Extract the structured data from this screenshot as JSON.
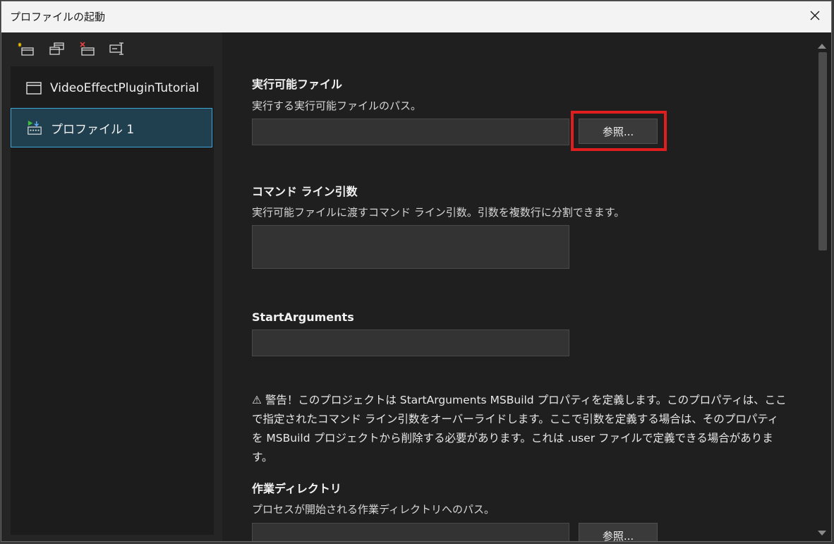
{
  "window": {
    "title": "プロファイルの起動",
    "close_glyph": "✕"
  },
  "toolbar": {
    "icons": [
      "new-profile-icon",
      "duplicate-profile-icon",
      "delete-profile-icon",
      "rename-profile-icon"
    ]
  },
  "tree": {
    "items": [
      {
        "label": "VideoEffectPluginTutorial",
        "icon": "window-icon",
        "selected": false
      },
      {
        "label": "プロファイル 1",
        "icon": "profile-launch-icon",
        "selected": true
      }
    ]
  },
  "executable": {
    "title": "実行可能ファイル",
    "description": "実行する実行可能ファイルのパス。",
    "value": "",
    "browse_label": "参照..."
  },
  "command_line": {
    "title": "コマンド ライン引数",
    "description": "実行可能ファイルに渡すコマンド ライン引数。引数を複数行に分割できます。",
    "value": ""
  },
  "start_arguments": {
    "title": "StartArguments",
    "value": ""
  },
  "warning": {
    "text": "⚠ 警告！このプロジェクトは StartArguments MSBuild プロパティを定義します。このプロパティは、ここで指定されたコマンド ライン引数をオーバーライドします。ここで引数を定義する場合は、そのプロパティを MSBuild プロジェクトから削除する必要があります。これは .user ファイルで定義できる場合があります。"
  },
  "working_directory": {
    "title": "作業ディレクトリ",
    "description": "プロセスが開始される作業ディレクトリへのパス。",
    "value": "",
    "browse_label": "参照..."
  },
  "colors": {
    "highlight": "#e01e1e",
    "selection_border": "#3fa4d6",
    "selection_bg": "#21404f"
  }
}
